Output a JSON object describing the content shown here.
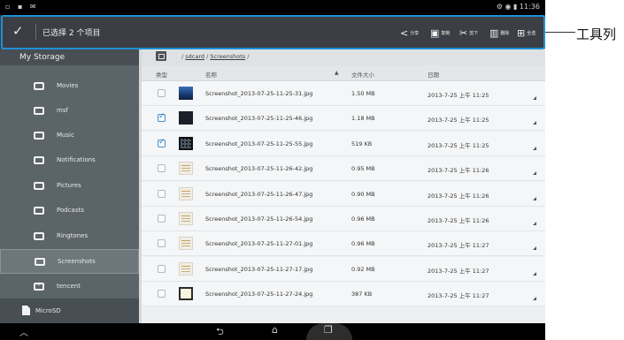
{
  "status_bar": {
    "left_icons": "▫ ▪ ✉",
    "right_text": "⚙ ◉ ▮ 11:36"
  },
  "action_bar": {
    "title": "已选择 2 个项目",
    "actions": [
      {
        "id": "share",
        "glyph": "<",
        "label": "分享"
      },
      {
        "id": "copy",
        "glyph": "▣",
        "label": "复制"
      },
      {
        "id": "cut",
        "glyph": "✂",
        "label": "剪下"
      },
      {
        "id": "delete",
        "glyph": "▥",
        "label": "删除"
      },
      {
        "id": "select_all",
        "glyph": "⊞",
        "label": "全选"
      }
    ]
  },
  "sidebar": {
    "header": "My Storage",
    "items": [
      {
        "label": "Movies"
      },
      {
        "label": "msf"
      },
      {
        "label": "Music"
      },
      {
        "label": "Notifications"
      },
      {
        "label": "Pictures"
      },
      {
        "label": "Podcasts"
      },
      {
        "label": "Ringtones"
      },
      {
        "label": "Screenshots"
      },
      {
        "label": "tencent"
      }
    ],
    "selected_item": "Screenshots",
    "microsd_label": "MicroSD"
  },
  "path_bar": {
    "separator": "/",
    "segments": [
      "sdcard",
      "Screenshots"
    ]
  },
  "table": {
    "columns": {
      "type": "类型",
      "name": "名称",
      "sort_indicator": "▲",
      "size": "文件大小",
      "date": "日期"
    },
    "rows": [
      {
        "name": "Screenshot_2013-07-25-11-25-31.jpg",
        "size": "1.50 MB",
        "date": "2013-7-25 上午 11:25",
        "checked": false,
        "thumb": "blue"
      },
      {
        "name": "Screenshot_2013-07-25-11-25-46.jpg",
        "size": "1.18 MB",
        "date": "2013-7-25 上午 11:25",
        "checked": true,
        "thumb": "dark"
      },
      {
        "name": "Screenshot_2013-07-25-11-25-55.jpg",
        "size": "519 KB",
        "date": "2013-7-25 上午 11:25",
        "checked": true,
        "thumb": "grid"
      },
      {
        "name": "Screenshot_2013-07-25-11-26-42.jpg",
        "size": "0.95 MB",
        "date": "2013-7-25 上午 11:26",
        "checked": false,
        "thumb": "light"
      },
      {
        "name": "Screenshot_2013-07-25-11-26-47.jpg",
        "size": "0.90 MB",
        "date": "2013-7-25 上午 11:26",
        "checked": false,
        "thumb": "light"
      },
      {
        "name": "Screenshot_2013-07-25-11-26-54.jpg",
        "size": "0.96 MB",
        "date": "2013-7-25 上午 11:26",
        "checked": false,
        "thumb": "light"
      },
      {
        "name": "Screenshot_2013-07-25-11-27-01.jpg",
        "size": "0.96 MB",
        "date": "2013-7-25 上午 11:27",
        "checked": false,
        "thumb": "light"
      },
      {
        "name": "Screenshot_2013-07-25-11-27-17.jpg",
        "size": "0.92 MB",
        "date": "2013-7-25 上午 11:27",
        "checked": false,
        "thumb": "light"
      },
      {
        "name": "Screenshot_2013-07-25-11-27-24.jpg",
        "size": "387 KB",
        "date": "2013-7-25 上午 11:27",
        "checked": false,
        "thumb": "frame"
      }
    ]
  },
  "nav_bar": {
    "up": "︿",
    "back": "⮌",
    "home": "⌂",
    "recent": "❐"
  },
  "callout": {
    "label": "工具列",
    "color": "#1f8fd6"
  }
}
